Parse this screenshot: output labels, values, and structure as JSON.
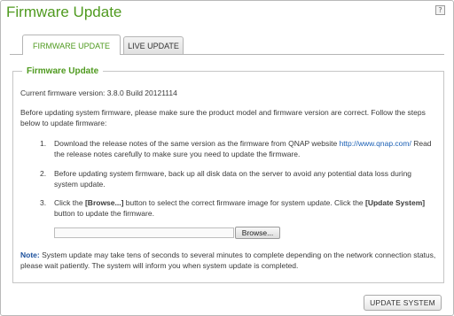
{
  "window": {
    "title": "Firmware Update",
    "help_glyph": "?"
  },
  "tabs": [
    {
      "label": "FIRMWARE UPDATE",
      "active": true
    },
    {
      "label": "LIVE UPDATE",
      "active": false
    }
  ],
  "section": {
    "legend": "Firmware Update",
    "current_version": "Current firmware version: 3.8.0 Build 20121114",
    "intro": "Before updating system firmware, please make sure the product model and firmware version are correct. Follow the steps below to update firmware:",
    "steps": [
      {
        "num": "1.",
        "text_before_link": "Download the release notes of the same version as the firmware from QNAP website ",
        "link": "http://www.qnap.com/",
        "text_after_link": " Read the release notes carefully to make sure you need to update the firmware."
      },
      {
        "num": "2.",
        "text": "Before updating system firmware, back up all disk data on the server to avoid any potential data loss during system update."
      },
      {
        "num": "3.",
        "text_a": "Click the ",
        "bold_a": "[Browse...]",
        "text_b": " button to select the correct firmware image for system update. Click the ",
        "bold_b": "[Update System]",
        "text_c": " button to update the firmware."
      }
    ],
    "file_value": "",
    "browse_label": "Browse...",
    "note_label": "Note:",
    "note_text": " System update may take tens of seconds to several minutes to complete depending on the network connection status, please wait patiently. The system will inform you when system update is completed."
  },
  "footer": {
    "update_button": "UPDATE SYSTEM"
  },
  "colors": {
    "accent": "#4f9a1f",
    "link": "#1a5fb4",
    "note": "#1a4f9c"
  }
}
